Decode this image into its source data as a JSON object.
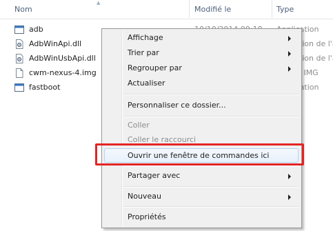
{
  "columns": {
    "name": "Nom",
    "modified": "Modifié le",
    "type": "Type"
  },
  "files": [
    {
      "name": "adb",
      "icon": "application-icon",
      "modified": "10/10/2014 09:18",
      "type": "Application"
    },
    {
      "name": "AdbWinApi.dll",
      "icon": "dll-file-icon",
      "modified": "",
      "type": "Extension de l'a"
    },
    {
      "name": "AdbWinUsbApi.dll",
      "icon": "dll-file-icon",
      "modified": "",
      "type": "Extension de l'a"
    },
    {
      "name": "cwm-nexus-4.img",
      "icon": "img-file-icon",
      "modified": "",
      "type": "Fichier IMG"
    },
    {
      "name": "fastboot",
      "icon": "application-icon",
      "modified": "",
      "type": "Application"
    }
  ],
  "menu": {
    "affichage": "Affichage",
    "trier": "Trier par",
    "regrouper": "Regrouper par",
    "actualiser": "Actualiser",
    "personnaliser": "Personnaliser ce dossier...",
    "coller": "Coller",
    "coller_raccourci": "Coller le raccourci",
    "ouvrir_commandes": "Ouvrir une fenêtre de commandes ici",
    "partager": "Partager avec",
    "nouveau": "Nouveau",
    "proprietes": "Propriétés"
  },
  "colors": {
    "highlight_border": "#e32424",
    "menu_background": "#f0f0f0"
  }
}
